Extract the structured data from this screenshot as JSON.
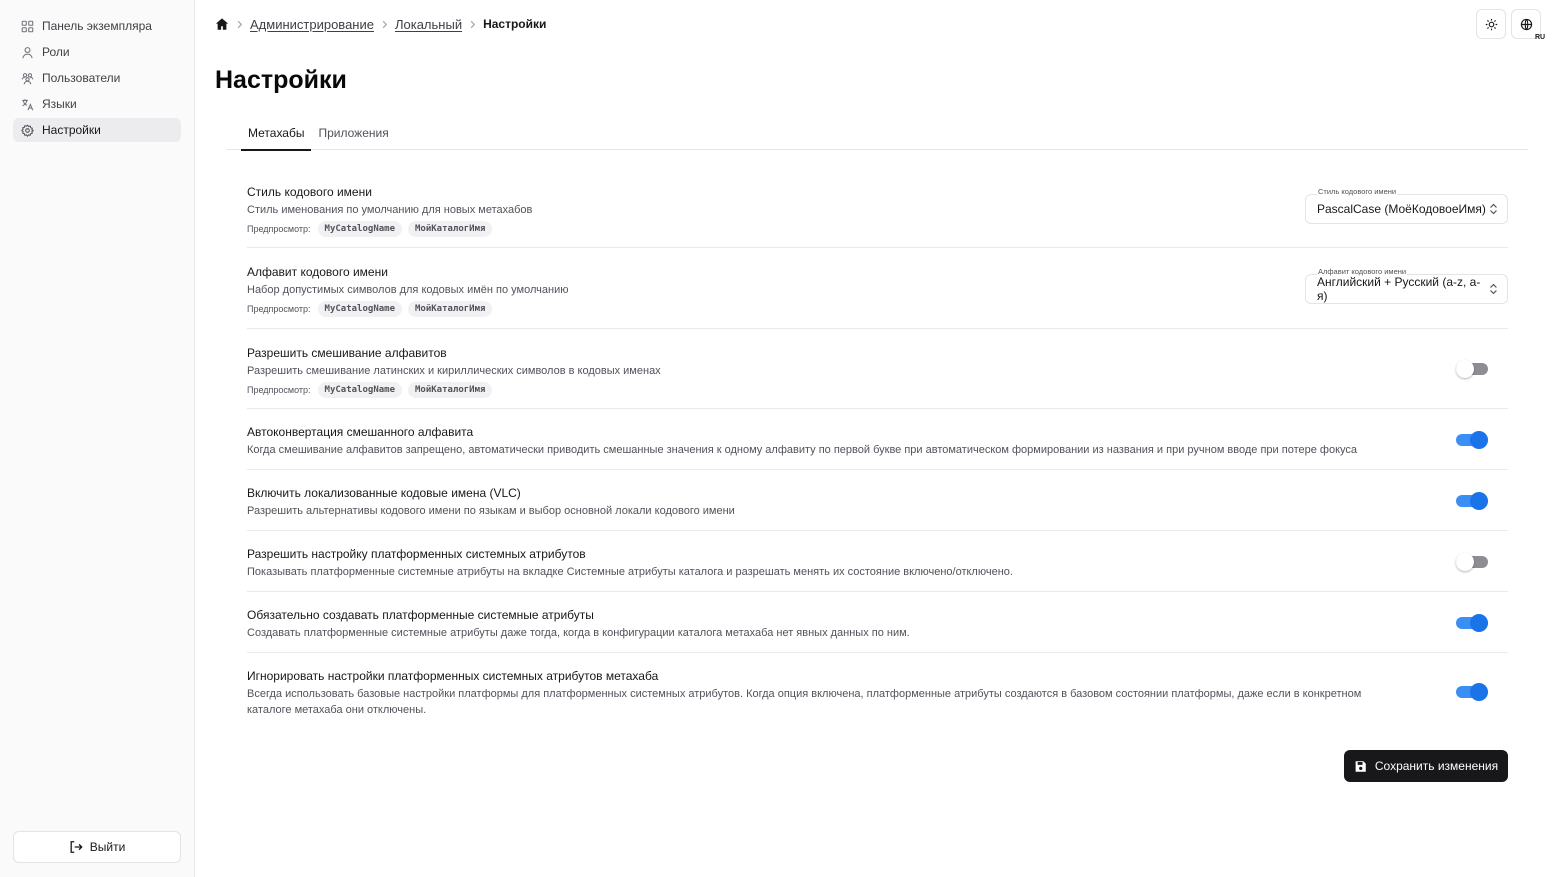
{
  "sidebar": {
    "items": [
      {
        "label": "Панель экземпляра",
        "icon": "layout-grid-icon"
      },
      {
        "label": "Роли",
        "icon": "user-icon"
      },
      {
        "label": "Пользователи",
        "icon": "users-icon"
      },
      {
        "label": "Языки",
        "icon": "languages-icon"
      },
      {
        "label": "Настройки",
        "icon": "gear-icon",
        "active": true
      }
    ],
    "logout_label": "Выйти"
  },
  "header": {
    "breadcrumb": [
      "Администрирование",
      "Локальный",
      "Настройки"
    ],
    "lang_badge": "RU"
  },
  "page": {
    "title": "Настройки",
    "tabs": [
      {
        "label": "Метахабы",
        "active": true
      },
      {
        "label": "Приложения",
        "active": false
      }
    ]
  },
  "settings": {
    "preview_label": "Предпросмотр:",
    "rows": [
      {
        "title": "Стиль кодового имени",
        "desc": "Стиль именования по умолчанию для новых метахабов",
        "preview": [
          "MyCatalogName",
          "МойКаталогИмя"
        ],
        "control": "select",
        "select_label": "Стиль кодового имени",
        "select_value": "PascalCase (МоёКодовоеИмя)"
      },
      {
        "title": "Алфавит кодового имени",
        "desc": "Набор допустимых символов для кодовых имён по умолчанию",
        "preview": [
          "MyCatalogName",
          "МойКаталогИмя"
        ],
        "control": "select",
        "select_label": "Алфавит кодового имени",
        "select_value": "Английский + Русский (a-z, а-я)"
      },
      {
        "title": "Разрешить смешивание алфавитов",
        "desc": "Разрешить смешивание латинских и кириллических символов в кодовых именах",
        "preview": [
          "MyCatalogName",
          "МойКаталогИмя"
        ],
        "control": "toggle",
        "enabled": false
      },
      {
        "title": "Автоконвертация смешанного алфавита",
        "desc": "Когда смешивание алфавитов запрещено, автоматически приводить смешанные значения к одному алфавиту по первой букве при автоматическом формировании из названия и при ручном вводе при потере фокуса",
        "control": "toggle",
        "enabled": true
      },
      {
        "title": "Включить локализованные кодовые имена (VLC)",
        "desc": "Разрешить альтернативы кодового имени по языкам и выбор основной локали кодового имени",
        "control": "toggle",
        "enabled": true
      },
      {
        "title": "Разрешить настройку платформенных системных атрибутов",
        "desc": "Показывать платформенные системные атрибуты на вкладке Системные атрибуты каталога и разрешать менять их состояние включено/отключено.",
        "control": "toggle",
        "enabled": false
      },
      {
        "title": "Обязательно создавать платформенные системные атрибуты",
        "desc": "Создавать платформенные системные атрибуты даже тогда, когда в конфигурации каталога метахаба нет явных данных по ним.",
        "control": "toggle",
        "enabled": true
      },
      {
        "title": "Игнорировать настройки платформенных системных атрибутов метахаба",
        "desc": "Всегда использовать базовые настройки платформы для платформенных системных атрибутов. Когда опция включена, платформенные атрибуты создаются в базовом состоянии платформы, даже если в конкретном каталоге метахаба они отключены.",
        "control": "toggle",
        "enabled": true
      }
    ]
  },
  "actions": {
    "save_label": "Сохранить изменения"
  },
  "colors": {
    "toggle_on": "#1a73e8",
    "primary_button": "#18181b"
  }
}
